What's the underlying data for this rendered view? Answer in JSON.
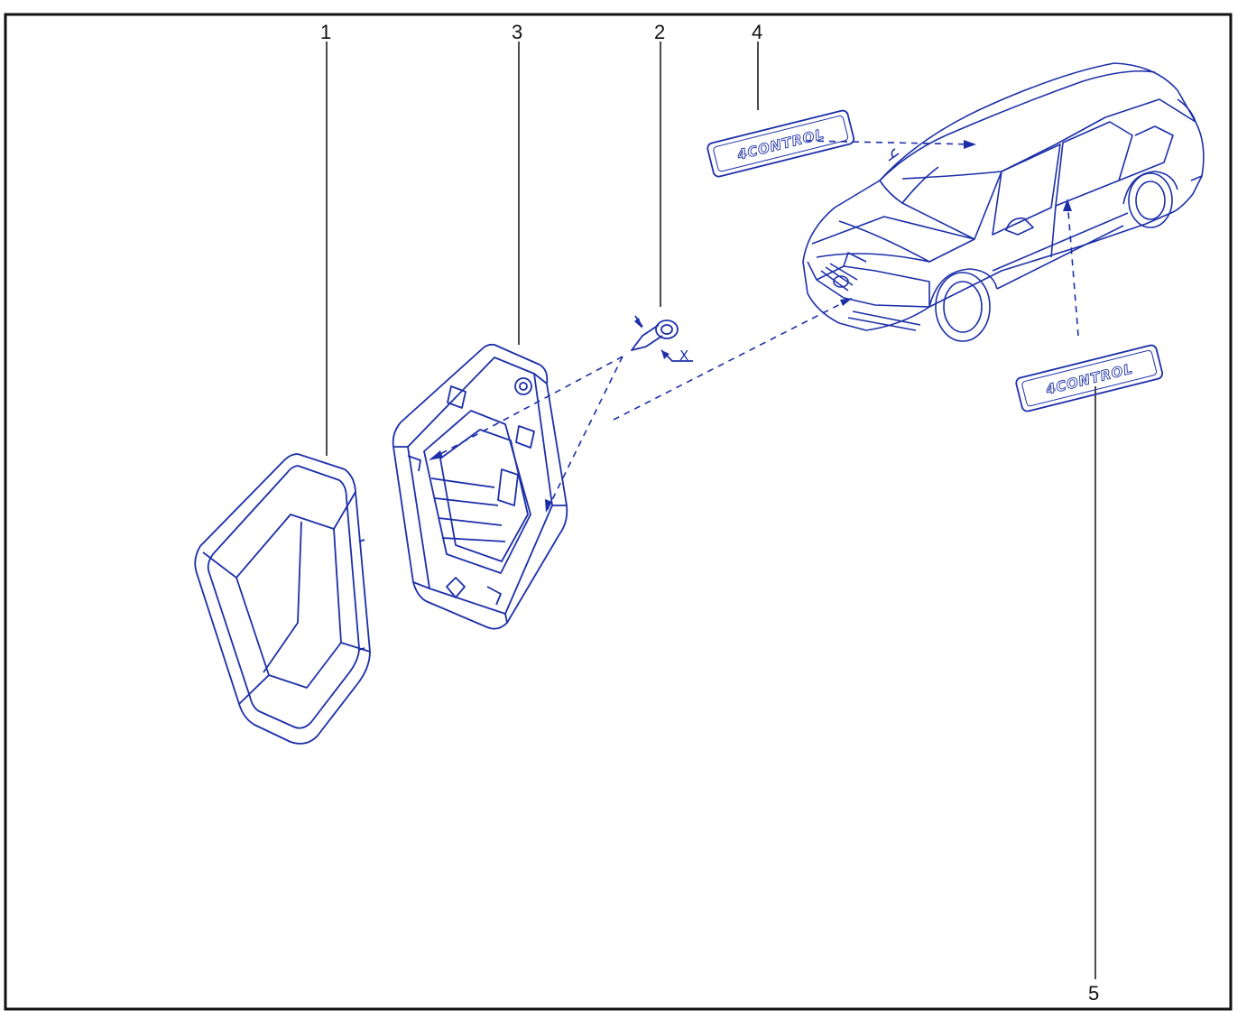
{
  "callouts": [
    {
      "id": "1",
      "label": "1"
    },
    {
      "id": "2",
      "label": "2"
    },
    {
      "id": "3",
      "label": "3"
    },
    {
      "id": "4",
      "label": "4"
    },
    {
      "id": "5",
      "label": "5"
    }
  ],
  "dimension_label": "X",
  "badge_text": "4CONTROL",
  "colors": {
    "line": "#1c2fa8",
    "frame": "#111111",
    "leader": "#111111"
  }
}
